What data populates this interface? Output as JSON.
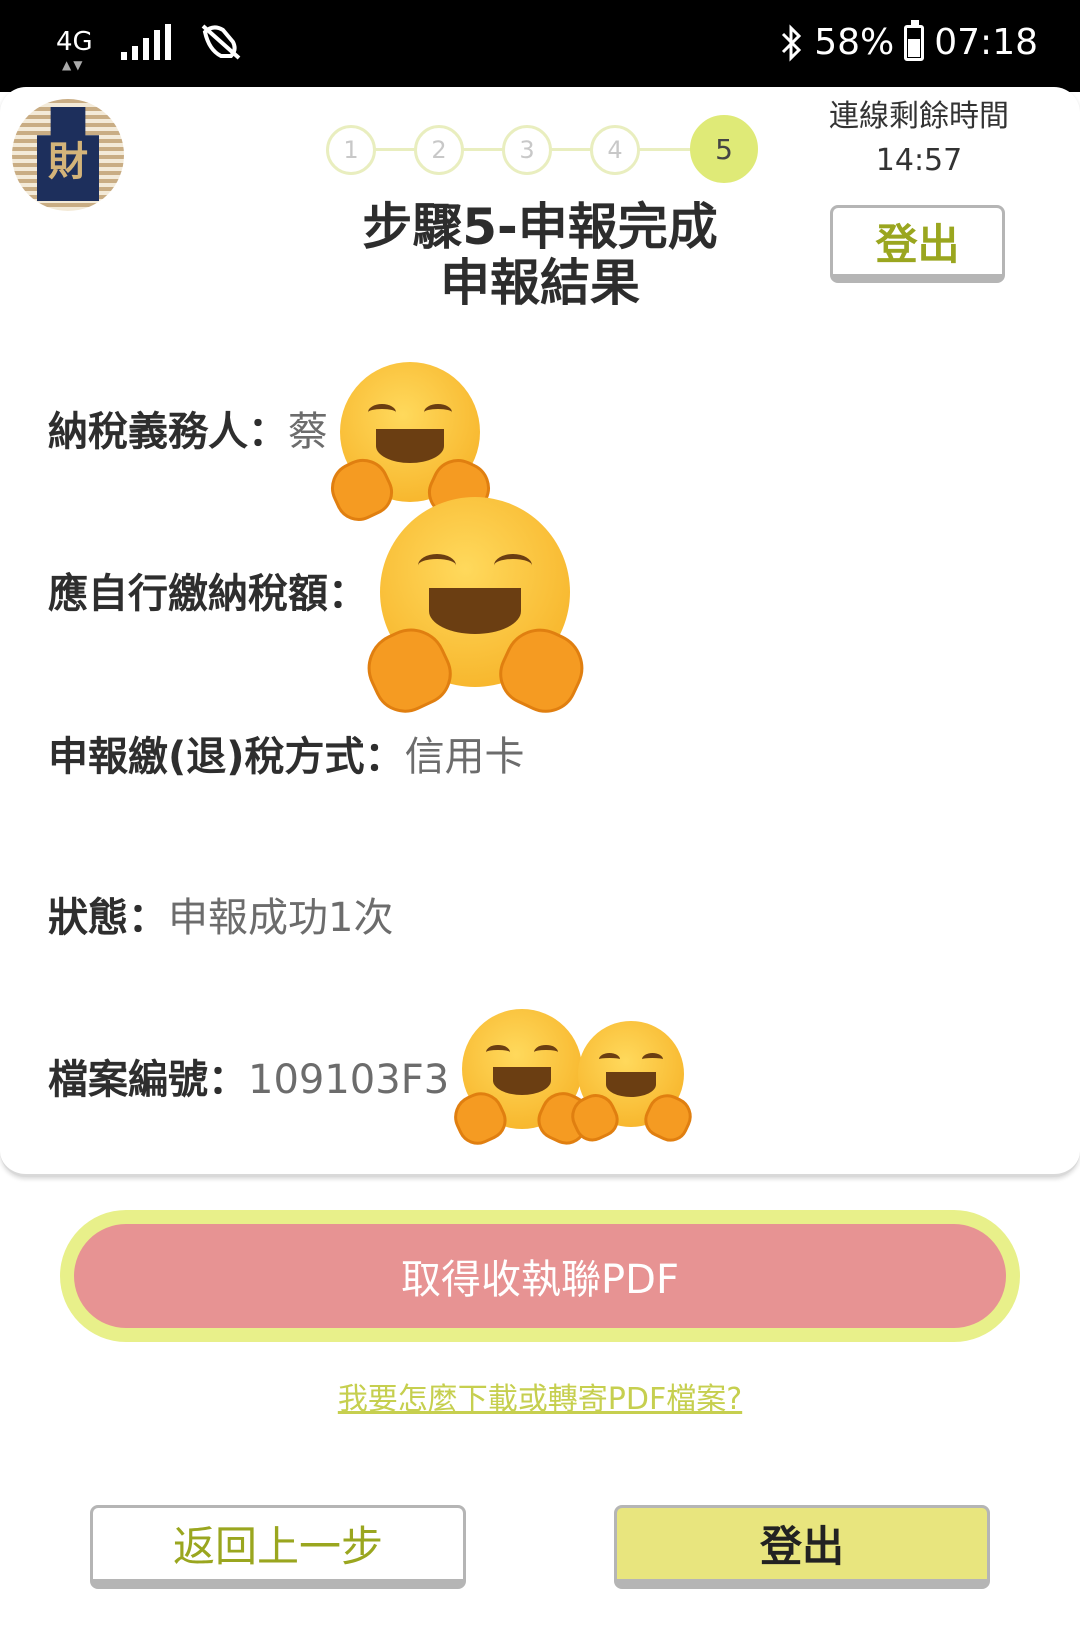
{
  "status_bar": {
    "network_type": "4G",
    "battery_percent": "58%",
    "battery_level": 0.58,
    "time": "07:18",
    "icons": [
      "signal-icon",
      "mute-icon",
      "bluetooth-icon",
      "battery-icon"
    ]
  },
  "header": {
    "logo_icon": "tax-bureau-logo",
    "steps": [
      "1",
      "2",
      "3",
      "4",
      "5"
    ],
    "active_step": "5",
    "title_line1": "步驟5-申報完成",
    "title_line2": "申報結果",
    "timer_label": "連線剩餘時間",
    "timer_value": "14:57",
    "logout_label": "登出"
  },
  "result": {
    "taxpayer_label": "納稅義務人：",
    "taxpayer_value": "蔡",
    "tax_due_label": "應自行繳納稅額：",
    "tax_due_value": "",
    "payment_method_label": "申報繳(退)稅方式：",
    "payment_method_value": "信用卡",
    "status_label": "狀態：",
    "status_value": "申報成功1次",
    "file_no_label": "檔案編號：",
    "file_no_value": "109103F3"
  },
  "actions": {
    "pdf_button_label": "取得收執聯PDF",
    "help_link": "我要怎麼下載或轉寄PDF檔案?",
    "back_button_label": "返回上一步",
    "logout_button_label": "登出"
  },
  "colors": {
    "accent_yellow": "#dfea77",
    "pdf_button": "#e79393",
    "logout_text": "#9aa61f",
    "link": "#c6cf4f"
  }
}
